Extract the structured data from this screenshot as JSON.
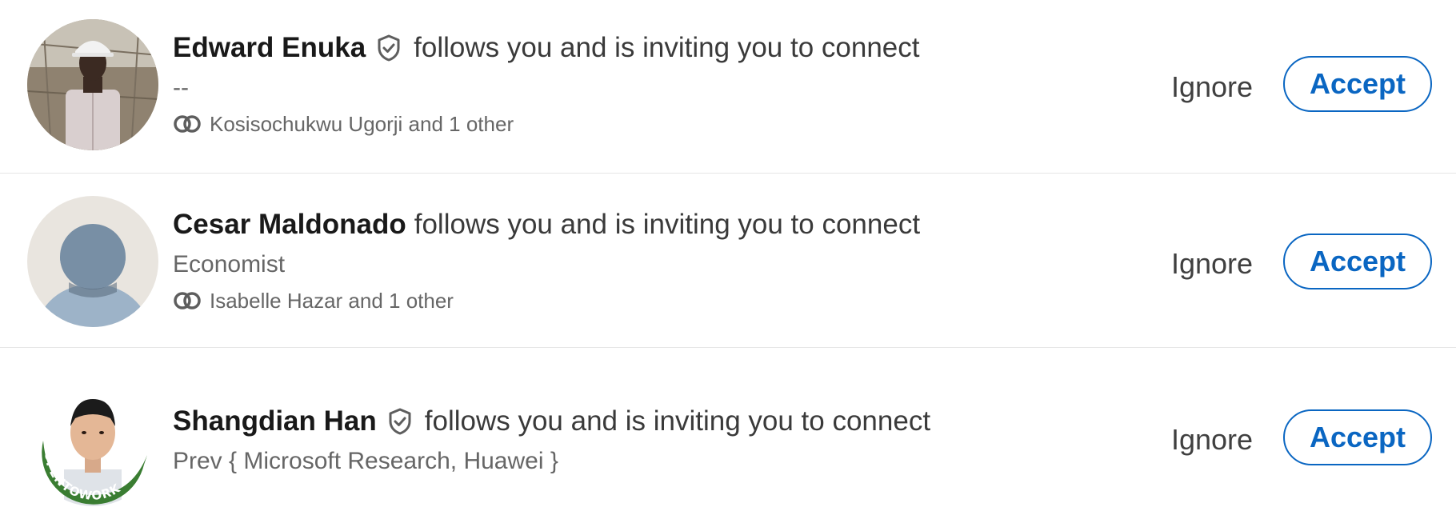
{
  "invitations": [
    {
      "name": "Edward Enuka",
      "verified": true,
      "action_text": "follows you and is inviting you to connect",
      "headline": "--",
      "mutual": "Kosisochukwu Ugorji and 1 other",
      "ignore_label": "Ignore",
      "accept_label": "Accept",
      "avatar_icon": "profile-photo-hard-hat"
    },
    {
      "name": "Cesar Maldonado",
      "verified": false,
      "action_text": "follows you and is inviting you to connect",
      "headline": "Economist",
      "mutual": "Isabelle Hazar and 1 other",
      "ignore_label": "Ignore",
      "accept_label": "Accept",
      "avatar_icon": "default-avatar-placeholder"
    },
    {
      "name": "Shangdian Han",
      "verified": true,
      "action_text": "follows you and is inviting you to connect",
      "headline": "Prev { Microsoft Research, Huawei }",
      "mutual": null,
      "ignore_label": "Ignore",
      "accept_label": "Accept",
      "avatar_icon": "profile-photo-opentowork-frame",
      "avatar_frame_text": "#OPENTOWORK"
    }
  ],
  "icons": {
    "verified": "verified-shield-icon",
    "mutual": "mutual-connections-icon"
  },
  "colors": {
    "accent": "#0a66c2",
    "text_primary": "#191919",
    "text_secondary": "#666666",
    "divider": "#e6e6e6",
    "opentowork_green": "#3a7d32"
  }
}
